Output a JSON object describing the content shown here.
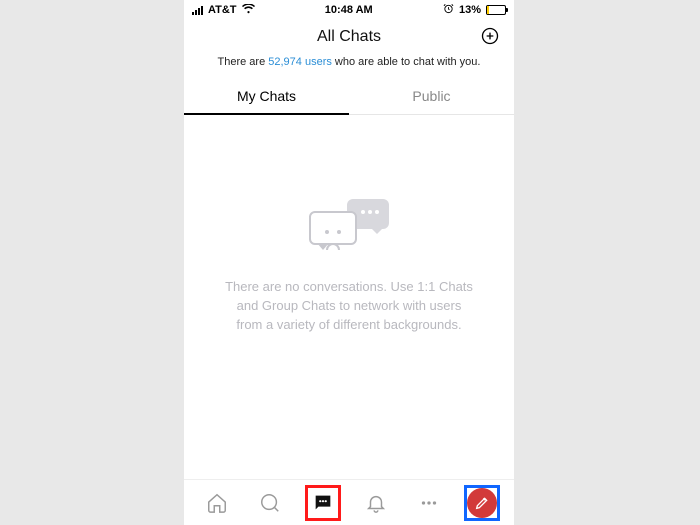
{
  "status": {
    "carrier": "AT&T",
    "time": "10:48 AM",
    "battery_pct": "13%"
  },
  "header": {
    "title": "All Chats"
  },
  "banner": {
    "prefix": "There are ",
    "count": "52,974 users",
    "suffix": " who are able to chat with you."
  },
  "tabs": {
    "my_chats": "My Chats",
    "public": "Public"
  },
  "empty": {
    "line1": "There are no conversations. Use 1:1 Chats",
    "line2": "and Group Chats to network with users",
    "line3": "from a variety of different backgrounds."
  }
}
